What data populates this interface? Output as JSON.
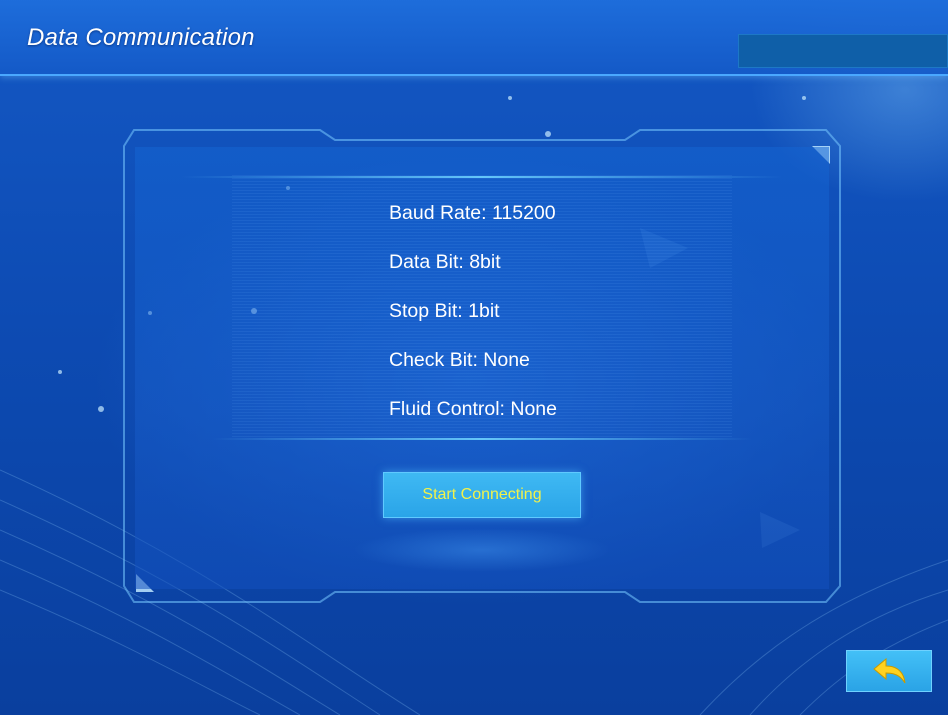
{
  "header": {
    "title": "Data Communication"
  },
  "settings": [
    {
      "label": "Baud Rate: 115200"
    },
    {
      "label": "Data Bit: 8bit"
    },
    {
      "label": "Stop Bit: 1bit"
    },
    {
      "label": "Check Bit: None"
    },
    {
      "label": "Fluid Control: None"
    }
  ],
  "actions": {
    "start_label": "Start Connecting",
    "back_icon": "back-arrow-icon"
  },
  "colors": {
    "background": "#0d4bb3",
    "button": "#2aa4e8",
    "button_text": "#f2f24a",
    "back_arrow": "#ffd21f"
  }
}
